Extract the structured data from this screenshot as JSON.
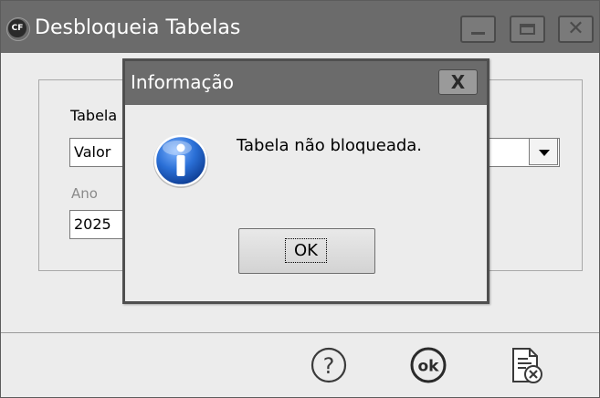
{
  "window": {
    "title": "Desbloqueia Tabelas",
    "app_icon_text": "CF"
  },
  "form": {
    "tabela_label": "Tabela",
    "tabela_value": "Valor",
    "ano_label": "Ano",
    "ano_value": "2025"
  },
  "footer": {
    "help_icon": "question-circle-icon",
    "ok_icon": "ok-circle-icon",
    "cancel_icon": "document-close-icon"
  },
  "dialog": {
    "title": "Informação",
    "close_label": "X",
    "message": "Tabela não bloqueada.",
    "ok_label": "OK",
    "icon": "info-icon"
  },
  "colors": {
    "titlebar": "#6b6b6b",
    "window_bg": "#ececec",
    "info_blue": "#1f5fbf"
  }
}
